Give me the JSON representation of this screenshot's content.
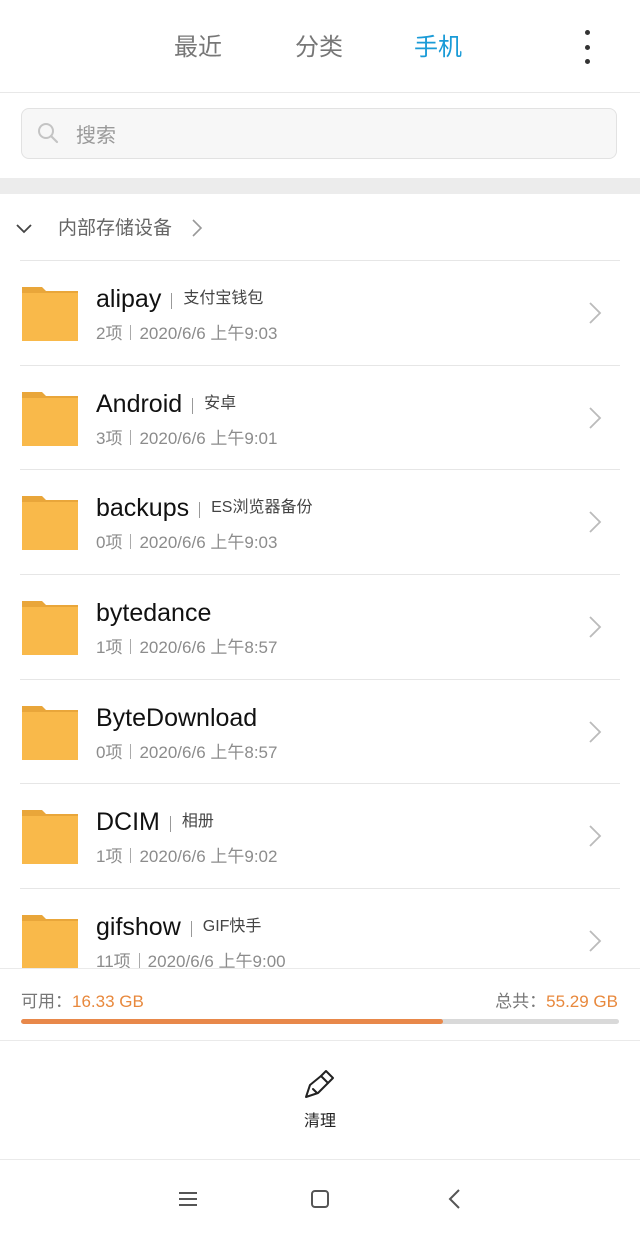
{
  "tabs": [
    {
      "label": "最近",
      "active": false
    },
    {
      "label": "分类",
      "active": false
    },
    {
      "label": "手机",
      "active": true
    }
  ],
  "search": {
    "placeholder": "搜索"
  },
  "breadcrumb": {
    "label": "内部存储设备"
  },
  "files": [
    {
      "name": "alipay",
      "alias": "支付宝钱包",
      "count": "2项",
      "date": "2020/6/6 上午9:03"
    },
    {
      "name": "Android",
      "alias": "安卓",
      "count": "3项",
      "date": "2020/6/6 上午9:01"
    },
    {
      "name": "backups",
      "alias": "ES浏览器备份",
      "count": "0项",
      "date": "2020/6/6 上午9:03"
    },
    {
      "name": "bytedance",
      "alias": "",
      "count": "1项",
      "date": "2020/6/6 上午8:57"
    },
    {
      "name": "ByteDownload",
      "alias": "",
      "count": "0项",
      "date": "2020/6/6 上午8:57"
    },
    {
      "name": "DCIM",
      "alias": "相册",
      "count": "1项",
      "date": "2020/6/6 上午9:02"
    },
    {
      "name": "gifshow",
      "alias": "GIF快手",
      "count": "11项",
      "date": "2020/6/6 上午9:00"
    }
  ],
  "storage": {
    "available_label": "可用：",
    "available_value": "16.33 GB",
    "total_label": "总共：",
    "total_value": "55.29 GB",
    "used_fraction": 0.705
  },
  "clean": {
    "label": "清理"
  },
  "colors": {
    "accent": "#1a9bd7",
    "folder": "#f9b94a",
    "storage": "#e8884a"
  },
  "icons": {
    "more": "more-vertical-icon",
    "search": "search-icon",
    "folder": "folder-icon",
    "clean": "broom-icon"
  }
}
